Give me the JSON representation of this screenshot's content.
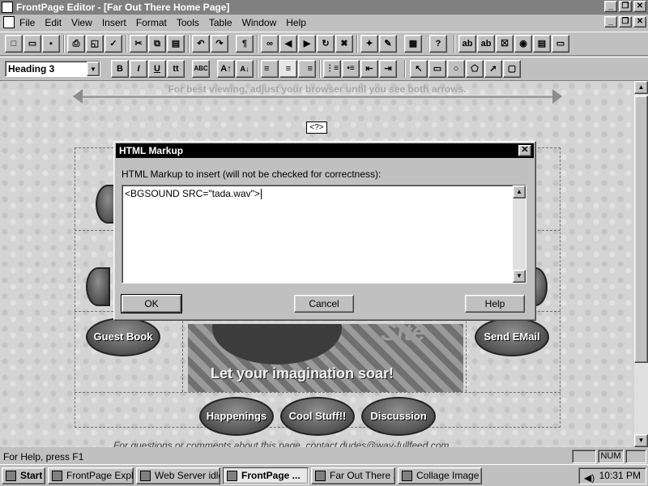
{
  "window": {
    "title": "FrontPage Editor - [Far Out There Home Page]",
    "buttons": [
      "_",
      "❐",
      "✕"
    ]
  },
  "menubar": {
    "items": [
      "File",
      "Edit",
      "View",
      "Insert",
      "Format",
      "Tools",
      "Table",
      "Window",
      "Help"
    ]
  },
  "toolbar1": {
    "buttons": [
      {
        "name": "new-icon",
        "glyph": "□"
      },
      {
        "name": "open-icon",
        "glyph": "▭"
      },
      {
        "name": "save-icon",
        "glyph": "▪"
      },
      {
        "name": "print-icon",
        "glyph": "⎙"
      },
      {
        "name": "print-preview-icon",
        "glyph": "◱"
      },
      {
        "name": "spelling-icon",
        "glyph": "✓"
      },
      {
        "name": "cut-icon",
        "glyph": "✂"
      },
      {
        "name": "copy-icon",
        "glyph": "⧉"
      },
      {
        "name": "paste-icon",
        "glyph": "▤"
      },
      {
        "name": "undo-icon",
        "glyph": "↶"
      },
      {
        "name": "redo-icon",
        "glyph": "↷"
      },
      {
        "name": "show-all-icon",
        "glyph": "¶"
      },
      {
        "name": "hyperlink-icon",
        "glyph": "∞"
      },
      {
        "name": "back-icon",
        "glyph": "◀"
      },
      {
        "name": "forward-icon",
        "glyph": "▶"
      },
      {
        "name": "refresh-icon",
        "glyph": "↻"
      },
      {
        "name": "stop-icon",
        "glyph": "✖"
      },
      {
        "name": "web-bot-icon",
        "glyph": "✦"
      },
      {
        "name": "image-icon",
        "glyph": "✎"
      },
      {
        "name": "table-icon",
        "glyph": "▦"
      },
      {
        "name": "help-pointer-icon",
        "glyph": "?"
      },
      {
        "name": "textbox-icon",
        "glyph": "ab"
      },
      {
        "name": "scrolling-textbox-icon",
        "glyph": "ab"
      },
      {
        "name": "checkbox-icon",
        "glyph": "☒"
      },
      {
        "name": "radio-icon",
        "glyph": "◉"
      },
      {
        "name": "dropdown-icon",
        "glyph": "▤"
      },
      {
        "name": "push-button-icon",
        "glyph": "▭"
      }
    ]
  },
  "toolbar2": {
    "style_value": "Heading 3",
    "buttons": [
      {
        "name": "bold-icon",
        "glyph": "B"
      },
      {
        "name": "italic-icon",
        "glyph": "I"
      },
      {
        "name": "underline-icon",
        "glyph": "U"
      },
      {
        "name": "typewriter-icon",
        "glyph": "tt"
      },
      {
        "name": "text-color-icon",
        "glyph": "ABC"
      },
      {
        "name": "increase-font-icon",
        "glyph": "A↑"
      },
      {
        "name": "decrease-font-icon",
        "glyph": "A↓"
      },
      {
        "name": "align-left-icon",
        "glyph": "≡"
      },
      {
        "name": "align-center-icon",
        "glyph": "≡"
      },
      {
        "name": "align-right-icon",
        "glyph": "≡"
      },
      {
        "name": "numbered-list-icon",
        "glyph": "⋮≡"
      },
      {
        "name": "bulleted-list-icon",
        "glyph": "•≡"
      },
      {
        "name": "decrease-indent-icon",
        "glyph": "⇤"
      },
      {
        "name": "increase-indent-icon",
        "glyph": "⇥"
      },
      {
        "name": "select-pointer-icon",
        "glyph": "↖"
      },
      {
        "name": "rectangle-icon",
        "glyph": "▭"
      },
      {
        "name": "circle-icon",
        "glyph": "○"
      },
      {
        "name": "polygon-icon",
        "glyph": "⬠"
      },
      {
        "name": "highlight-hotspots-icon",
        "glyph": "➚"
      },
      {
        "name": "make-transparent-icon",
        "glyph": "▢"
      }
    ]
  },
  "page": {
    "tip": "For best viewing, adjust your browser until you see both arrows.",
    "html_marker": "<?>",
    "nav_buttons": {
      "guest_book": "Guest Book",
      "send_email": "Send EMail",
      "happenings": "Happenings",
      "cool_stuff": "Cool Stuff!!",
      "discussion": "Discussion"
    },
    "collage": {
      "site_text": "Site",
      "tagline": "Let your imagination soar!"
    },
    "footer_text": "For questions or comments about this page, contact dudes@way-fullfeed.com"
  },
  "dialog": {
    "title": "HTML Markup",
    "close_glyph": "✕",
    "label": "HTML Markup to insert (will not be checked for correctness):",
    "markup_value": "<BGSOUND SRC=\"tada.wav\">",
    "ok_label": "OK",
    "cancel_label": "Cancel",
    "help_label": "Help"
  },
  "statusbar": {
    "help_text": "For Help, press F1",
    "num_indicator": "NUM"
  },
  "taskbar": {
    "start_label": "Start",
    "tasks": [
      "FrontPage Expl...",
      "Web Server idle",
      "FrontPage ...",
      "Far Out There ...",
      "Collage Image ..."
    ],
    "clock": "10:31 PM"
  }
}
